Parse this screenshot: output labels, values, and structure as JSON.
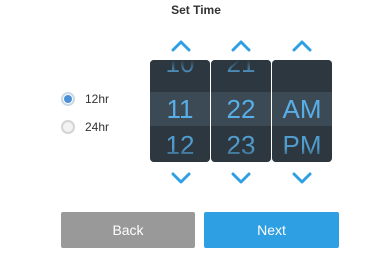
{
  "title": "Set Time",
  "format": {
    "options": [
      {
        "label": "12hr",
        "checked": true
      },
      {
        "label": "24hr",
        "checked": false
      }
    ]
  },
  "wheels": {
    "hour": {
      "prev": "10",
      "current": "11",
      "next": "12"
    },
    "minute": {
      "prev": "21",
      "current": "22",
      "next": "23"
    },
    "period": {
      "prev": "",
      "current": "AM",
      "next": "PM"
    }
  },
  "buttons": {
    "back": "Back",
    "next": "Next"
  },
  "icons": {
    "up": "chevron-up-icon",
    "down": "chevron-down-icon"
  },
  "colors": {
    "accent": "#2f9fe4",
    "wheel_bg": "#2c3740",
    "wheel_text": "#58aee6",
    "back_bg": "#999999"
  }
}
